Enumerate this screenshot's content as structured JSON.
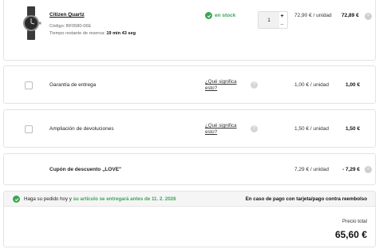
{
  "product": {
    "name": "Citizen Quartz",
    "code": "Código: BF0580-06E",
    "timer_prefix": "Tiempo restante de reserva:",
    "timer_value": "19 min 43 seg",
    "stock": "en stock",
    "quantity": "1",
    "plus": "+",
    "minus": "–",
    "unit_price": "72,90 € / unidad",
    "total": "72,89 €",
    "remove": "×"
  },
  "options": [
    {
      "label": "Garantía de entrega",
      "link": "¿Qué significa esto?",
      "help": "?",
      "unit_price": "1,00 € / unidad",
      "total": "1,00 €"
    },
    {
      "label": "Ampliación de devoluciones",
      "link": "¿Qué significa esto?",
      "help": "?",
      "unit_price": "1,50 € / unidad",
      "total": "1,50 €"
    }
  ],
  "coupon": {
    "label": "Cupón de descuento „LOVE\"",
    "unit_price": "7,29 € / unidad",
    "total": "- 7,29 €",
    "remove": "×"
  },
  "summary": {
    "msg_prefix": "Haga su pedido hoy y",
    "msg_highlight": "su artículo se entregará antes de 11. 2. 2026",
    "payment_note": "En caso de pago con tarjeta/pago contra reembolso",
    "total_label": "Precio total",
    "total_value": "65,60 €"
  },
  "colors": {
    "accent_green": "#3aa655",
    "muted_grey": "#cfcfcf"
  }
}
